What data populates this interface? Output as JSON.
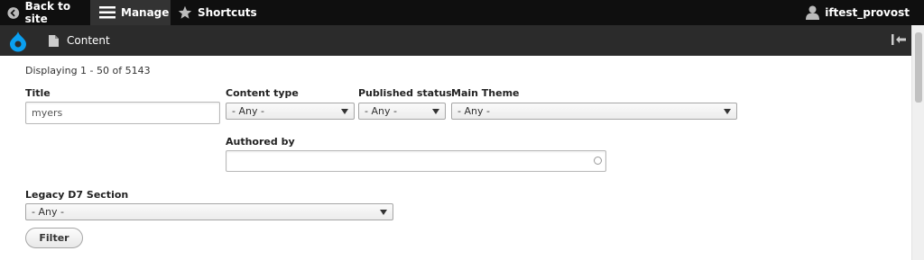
{
  "toolbar": {
    "back_label": "Back to site",
    "manage_label": "Manage",
    "shortcuts_label": "Shortcuts",
    "user_label": "iftest_provost"
  },
  "tray": {
    "content_label": "Content"
  },
  "results": {
    "display_count": "Displaying 1 - 50 of 5143"
  },
  "filters": {
    "title_label": "Title",
    "title_value": "myers",
    "content_type_label": "Content type",
    "content_type_value": "- Any -",
    "published_label": "Published status",
    "published_value": "- Any -",
    "main_theme_label": "Main Theme",
    "main_theme_value": "- Any -",
    "authored_by_label": "Authored by",
    "authored_by_value": "",
    "legacy_label": "Legacy D7 Section",
    "legacy_value": "- Any -",
    "filter_button": "Filter"
  },
  "colors": {
    "toolbar_bg": "#0f0f0f",
    "tray_bg": "#2b2b2b",
    "drupal_blue": "#0a9ff0"
  }
}
